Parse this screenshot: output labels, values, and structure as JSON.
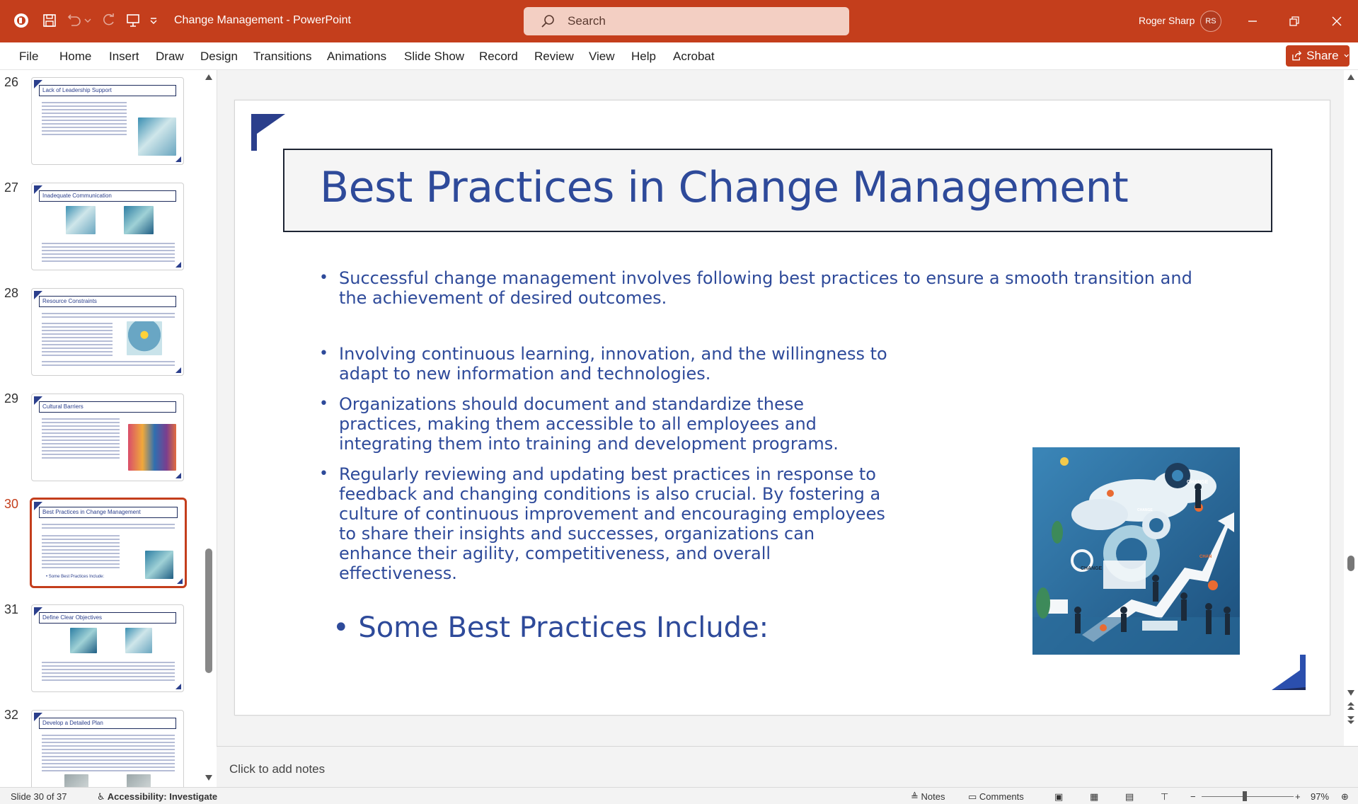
{
  "app": {
    "title": "Change Management  -  PowerPoint",
    "accent": "#c43e1c"
  },
  "search": {
    "placeholder": "Search"
  },
  "user": {
    "name": "Roger Sharp",
    "initials": "RS"
  },
  "ribbon": {
    "tabs": [
      "File",
      "Home",
      "Insert",
      "Draw",
      "Design",
      "Transitions",
      "Animations",
      "Slide Show",
      "Record",
      "Review",
      "View",
      "Help",
      "Acrobat"
    ],
    "share_label": "Share"
  },
  "thumbnails": [
    {
      "number": "26",
      "title": "Lack of Leadership Support"
    },
    {
      "number": "27",
      "title": "Inadequate Communication"
    },
    {
      "number": "28",
      "title": "Resource Constraints"
    },
    {
      "number": "29",
      "title": "Cultural Barriers"
    },
    {
      "number": "30",
      "title": "Best Practices in Change Management",
      "mini_bullet": "• Some Best Practices Include:",
      "active": true
    },
    {
      "number": "31",
      "title": "Define Clear Objectives"
    },
    {
      "number": "32",
      "title": "Develop a Detailed Plan"
    }
  ],
  "slide": {
    "title": "Best Practices in Change Management",
    "bullets": [
      "Successful change management involves following best practices to ensure a smooth transition and the achievement of desired outcomes.",
      "Involving continuous learning, innovation, and the willingness to adapt to new information and technologies.",
      "Organizations should document and standardize these practices, making them accessible to all employees and integrating them into training and development programs.",
      "Regularly reviewing and updating best practices in response to feedback and changing conditions is also crucial. By fostering a culture of continuous improvement and encouraging employees to share their insights and successes, organizations can enhance their agility, competitiveness, and overall effectiveness."
    ],
    "big_bullet": "Some Best Practices Include:",
    "image_labels": [
      "CHANGE",
      "CHANGE",
      "CHANGE",
      "CHAN"
    ]
  },
  "notes": {
    "placeholder": "Click to add notes"
  },
  "status": {
    "slide_indicator": "Slide 30 of 37",
    "accessibility": "Accessibility: Investigate",
    "notes_label": "Notes",
    "comments_label": "Comments",
    "zoom": "97%"
  }
}
